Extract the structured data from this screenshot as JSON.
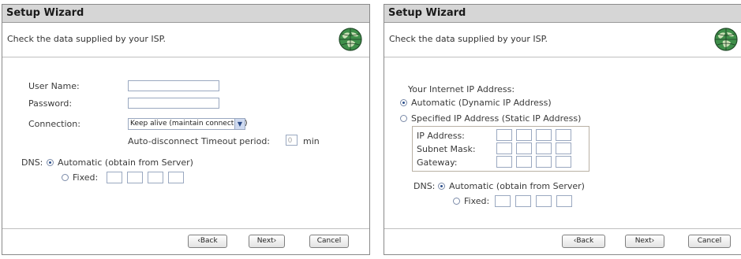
{
  "left": {
    "title": "Setup Wizard",
    "subheader": "Check the data supplied by your ISP.",
    "user_name_label": "User Name:",
    "user_name_value": "",
    "password_label": "Password:",
    "password_value": "",
    "connection_label": "Connection:",
    "connection_selected": "Keep alive (maintain connection)",
    "timeout_label": "Auto-disconnect Timeout period:",
    "timeout_value": "0",
    "timeout_unit": "min",
    "dns_label": "DNS:",
    "dns_automatic": "Automatic (obtain from Server)",
    "dns_fixed": "Fixed:",
    "back": "‹Back",
    "next": "Next›",
    "cancel": "Cancel"
  },
  "right": {
    "title": "Setup Wizard",
    "subheader": "Check the data supplied by your ISP.",
    "ip_heading": "Your Internet IP Address:",
    "automatic_option": "Automatic (Dynamic IP Address)",
    "specified_option": "Specified IP Address (Static IP Address)",
    "ip_address_label": "IP Address:",
    "subnet_mask_label": "Subnet Mask:",
    "gateway_label": "Gateway:",
    "dns_label": "DNS:",
    "dns_automatic": "Automatic (obtain from Server)",
    "dns_fixed": "Fixed:",
    "back": "‹Back",
    "next": "Next›",
    "cancel": "Cancel"
  },
  "icons": {
    "globe": "globe-icon",
    "dropdown": "chevron-down-icon"
  }
}
